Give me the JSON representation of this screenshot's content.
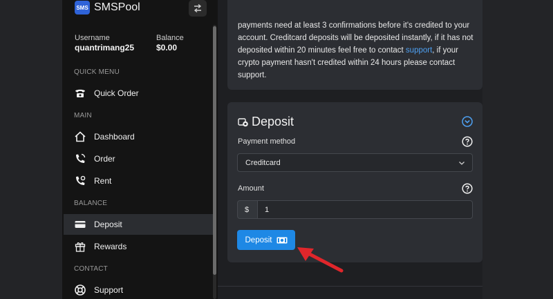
{
  "sidebar": {
    "brand_name": "SMSPool",
    "logo_text": "SMS",
    "account": {
      "username_label": "Username",
      "username": "quantrimang25",
      "balance_label": "Balance",
      "balance": "$0.00"
    },
    "sections": {
      "quick_menu": "QUICK MENU",
      "main": "MAIN",
      "balance": "BALANCE",
      "contact": "CONTACT"
    },
    "items": [
      {
        "label": "Quick Order",
        "icon": "phone-icon"
      },
      {
        "label": "Dashboard",
        "icon": "home-icon"
      },
      {
        "label": "Order",
        "icon": "phone-call-icon"
      },
      {
        "label": "Rent",
        "icon": "phone-settings-icon"
      },
      {
        "label": "Deposit",
        "icon": "credit-card-icon",
        "active": true
      },
      {
        "label": "Rewards",
        "icon": "gift-icon"
      },
      {
        "label": "Support",
        "icon": "support-icon"
      }
    ]
  },
  "info": {
    "line1": "payments need at least 3 confirmations before it's credited to your account. Creditcard deposits will be deposited instantly, if it has not deposited within 20 minutes feel free to contact ",
    "link": "support",
    "line2": ", if your crypto payment hasn't credited within 24 hours please contact support."
  },
  "deposit": {
    "title": "Deposit",
    "payment_method_label": "Payment method",
    "payment_method_value": "Creditcard",
    "amount_label": "Amount",
    "currency_symbol": "$",
    "amount_value": "1",
    "button_label": "Deposit"
  },
  "colors": {
    "accent": "#1e88e5",
    "link": "#4ea1f3",
    "annotation_arrow": "#e0262b"
  }
}
